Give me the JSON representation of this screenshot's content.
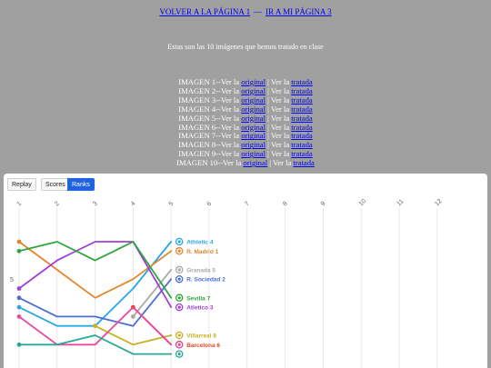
{
  "nav": {
    "back_label": "VOLVER A LA PÁGINA 1",
    "next_label": "IR A MI PÁGINA 3"
  },
  "intro": "Estas son las 10 imágenes que hemos tratado en clase",
  "images": [
    {
      "prefix": "IMAGEN 1--Ver la ",
      "original": "original",
      "middle": " | Ver la ",
      "treated": "tratada"
    },
    {
      "prefix": "IMAGEN 2--Ver la ",
      "original": "original",
      "middle": " | Ver la ",
      "treated": "tratada"
    },
    {
      "prefix": "IMAGEN 3--Ver la ",
      "original": "original",
      "middle": " | Ver la ",
      "treated": "tratada"
    },
    {
      "prefix": "IMAGEN 4--Ver la ",
      "original": "original",
      "middle": " | Ver la ",
      "treated": "tratada"
    },
    {
      "prefix": "IMAGEN 5--Ver la ",
      "original": "original",
      "middle": " | Ver la ",
      "treated": "tratada"
    },
    {
      "prefix": "IMAGEN 6--Ver la ",
      "original": "original",
      "middle": " | Ver la ",
      "treated": "tratada"
    },
    {
      "prefix": "IMAGEN 7--Ver la ",
      "original": "original",
      "middle": " | Ver la ",
      "treated": "tratada"
    },
    {
      "prefix": "IMAGEN 8--Ver la ",
      "original": "original",
      "middle": " | Ver la ",
      "treated": "tratada"
    },
    {
      "prefix": "IMAGEN 9--Ver la ",
      "original": "original",
      "middle": " | Ver la ",
      "treated": "tratada"
    },
    {
      "prefix": "IMAGEN 10--Ver la ",
      "original": "original",
      "middle": " | Ver la ",
      "treated": "tratada"
    }
  ],
  "widget": {
    "replay_label": "Replay",
    "scores_label": "Scores",
    "ranks_label": "Ranks",
    "accent": "#1f63e0"
  },
  "chart_data": {
    "type": "line",
    "x": [
      1,
      2,
      3,
      4,
      5,
      6,
      7,
      8,
      9,
      10,
      11,
      12
    ],
    "x_visible_max": 5,
    "y_axis_tick_label": "5",
    "y_axis_tick_value": 5,
    "y_inverted": true,
    "grid": "vertical",
    "series": [
      {
        "name": "Athletic",
        "rank": 4,
        "color": "#2aa7e8",
        "values": [
          8,
          10,
          10,
          6,
          1
        ]
      },
      {
        "name": "R. Madrid",
        "rank": 1,
        "color": "#e5862c",
        "values": [
          1,
          4,
          7,
          5,
          2
        ]
      },
      {
        "name": "Granada",
        "rank": 5,
        "color": "#a8a8a8",
        "values": [
          null,
          null,
          null,
          9,
          4
        ]
      },
      {
        "name": "R. Sociedad",
        "rank": 2,
        "color": "#4b6ed8",
        "values": [
          7,
          9,
          9,
          10,
          5
        ]
      },
      {
        "name": "Atletico",
        "rank": 3,
        "color": "#a040d8",
        "values": [
          6,
          3,
          1,
          1,
          8
        ]
      },
      {
        "name": "Sevilla",
        "rank": 7,
        "color": "#2ea73f",
        "values": [
          2,
          1,
          3,
          1,
          7
        ]
      },
      {
        "name": "Villarreal",
        "rank": 8,
        "color": "#c8b020",
        "values": [
          null,
          null,
          10,
          12,
          11
        ]
      },
      {
        "name": "Barcelona",
        "rank": 6,
        "color": "#e84420",
        "values": [
          null,
          null,
          null,
          8,
          12
        ]
      },
      {
        "name": null,
        "rank": null,
        "color": "#e84a9e",
        "values": [
          9,
          12,
          12,
          8,
          12
        ]
      },
      {
        "name": null,
        "rank": null,
        "color": "#28a896",
        "values": [
          12,
          12,
          11,
          13,
          13
        ]
      }
    ]
  }
}
